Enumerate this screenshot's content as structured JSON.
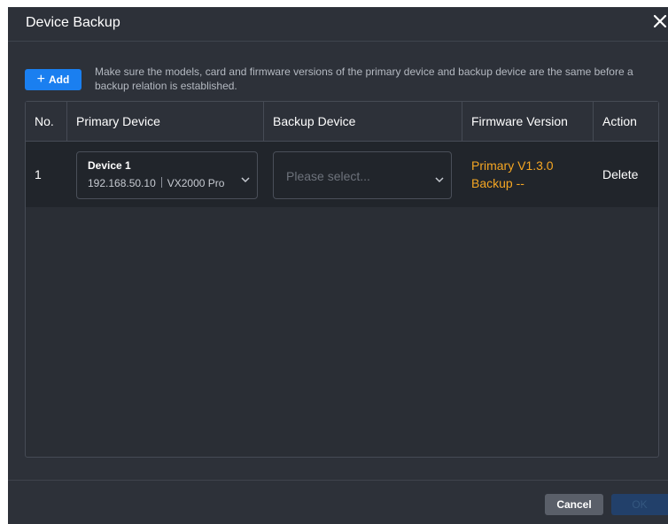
{
  "dialog": {
    "title": "Device Backup"
  },
  "toolbar": {
    "add_label": "Add",
    "notice": "Make sure the models, card and firmware versions of the primary device and backup device are the same before a backup relation is established."
  },
  "table": {
    "columns": [
      "No.",
      "Primary Device",
      "Backup Device",
      "Firmware Version",
      "Action"
    ],
    "rows": [
      {
        "no": "1",
        "primary": {
          "name": "Device 1",
          "ip": "192.168.50.10",
          "model": "VX2000 Pro"
        },
        "backup": {
          "placeholder": "Please select..."
        },
        "firmware_primary": "Primary V1.3.0",
        "firmware_backup": "Backup --",
        "action": "Delete"
      }
    ]
  },
  "footer": {
    "cancel_label": "Cancel",
    "ok_label": "OK"
  },
  "colors": {
    "accent": "#1a7ff0",
    "warning": "#f5a623",
    "background": "#2d3139"
  }
}
